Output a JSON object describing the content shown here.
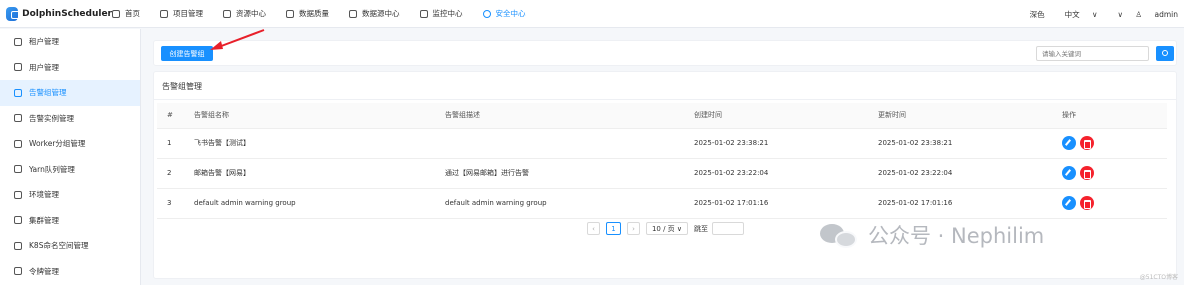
{
  "app": {
    "logo_text": "DolphinScheduler"
  },
  "nav": [
    {
      "label": "首页",
      "icon": "home-icon",
      "active": false
    },
    {
      "label": "项目管理",
      "icon": "project-icon",
      "active": false
    },
    {
      "label": "资源中心",
      "icon": "folder-icon",
      "active": false
    },
    {
      "label": "数据质量",
      "icon": "database-icon",
      "active": false
    },
    {
      "label": "数据源中心",
      "icon": "datasource-icon",
      "active": false
    },
    {
      "label": "监控中心",
      "icon": "monitor-icon",
      "active": false
    },
    {
      "label": "安全中心",
      "icon": "shield-icon",
      "active": true
    }
  ],
  "header_right": {
    "theme": "深色",
    "language": "中文",
    "user": "admin"
  },
  "sidebar": [
    {
      "label": "租户管理",
      "icon": "tenant-icon",
      "active": false
    },
    {
      "label": "用户管理",
      "icon": "user-icon",
      "active": false
    },
    {
      "label": "告警组管理",
      "icon": "warning-icon",
      "active": true
    },
    {
      "label": "告警实例管理",
      "icon": "alert-instance-icon",
      "active": false
    },
    {
      "label": "Worker分组管理",
      "icon": "worker-icon",
      "active": false
    },
    {
      "label": "Yarn队列管理",
      "icon": "yarn-icon",
      "active": false
    },
    {
      "label": "环境管理",
      "icon": "environment-icon",
      "active": false
    },
    {
      "label": "集群管理",
      "icon": "cluster-icon",
      "active": false
    },
    {
      "label": "K8S命名空间管理",
      "icon": "k8s-icon",
      "active": false
    },
    {
      "label": "令牌管理",
      "icon": "token-icon",
      "active": false
    }
  ],
  "toolbar": {
    "create_label": "创建告警组",
    "search_placeholder": "请输入关键词"
  },
  "card": {
    "title": "告警组管理"
  },
  "table": {
    "headers": [
      "#",
      "告警组名称",
      "告警组描述",
      "创建时间",
      "更新时间",
      "操作"
    ],
    "rows": [
      {
        "index": "1",
        "name": "飞书告警【测试】",
        "description": "",
        "created": "2025-01-02 23:38:21",
        "updated": "2025-01-02 23:38:21"
      },
      {
        "index": "2",
        "name": "邮箱告警【网易】",
        "description": "通过【网易邮箱】进行告警",
        "created": "2025-01-02 23:22:04",
        "updated": "2025-01-02 23:22:04"
      },
      {
        "index": "3",
        "name": "default admin warning group",
        "description": "default admin warning group",
        "created": "2025-01-02 17:01:16",
        "updated": "2025-01-02 17:01:16"
      }
    ]
  },
  "pagination": {
    "current_page": "1",
    "page_size": "10 / 页",
    "jump_label": "跳至"
  },
  "watermark": {
    "text": "公众号 · Nephilim",
    "credit": "@51CTO博客"
  },
  "colors": {
    "primary": "#1890ff",
    "danger": "#f5222d",
    "annotation_arrow": "#e8202a"
  }
}
